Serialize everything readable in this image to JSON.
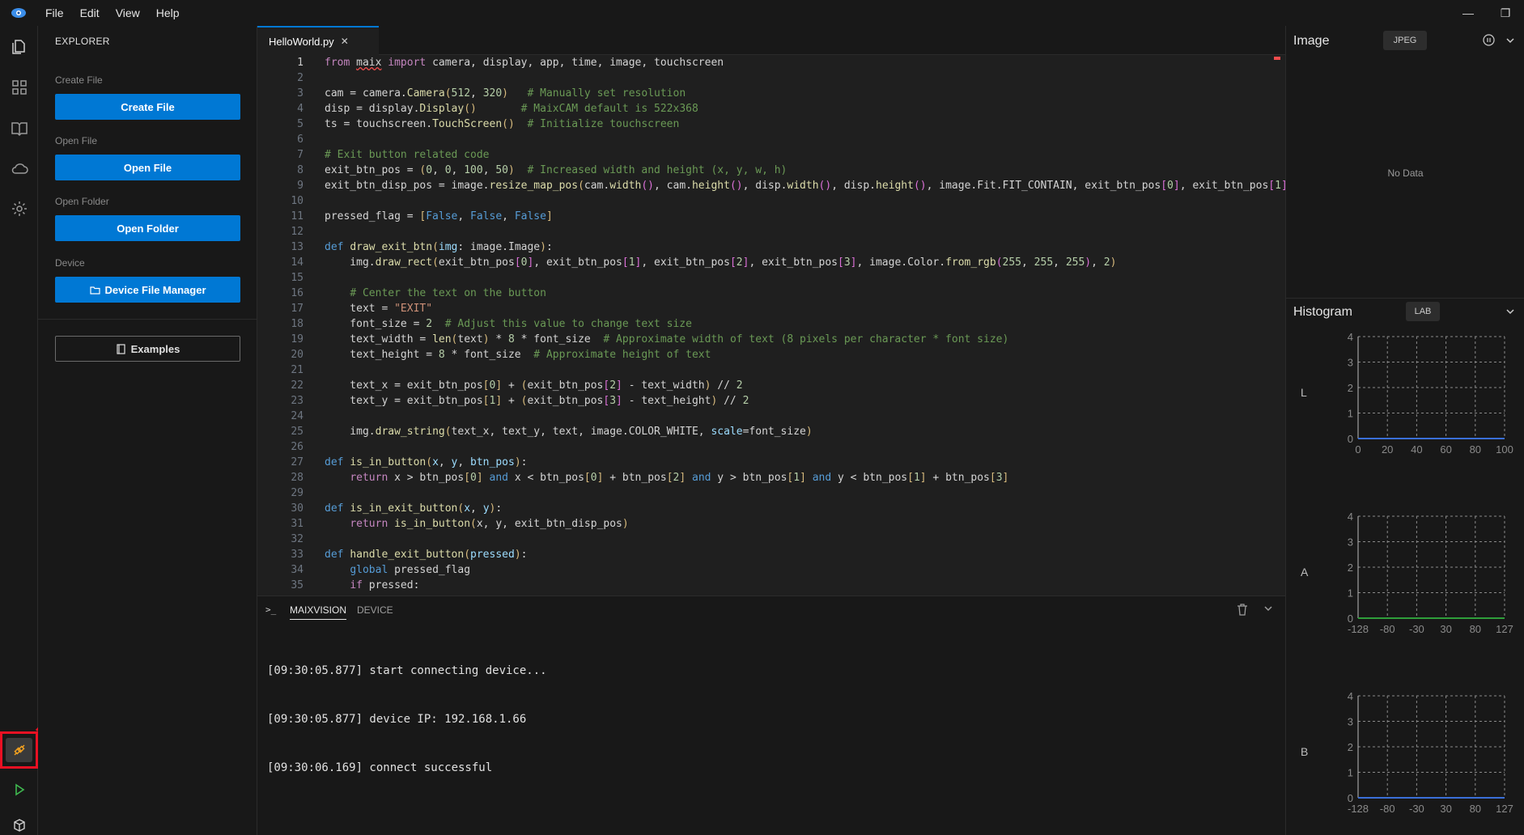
{
  "menu": {
    "file": "File",
    "edit": "Edit",
    "view": "View",
    "help": "Help"
  },
  "window": {
    "minimize": "—",
    "restore": "❐"
  },
  "sidebar": {
    "title": "EXPLORER",
    "create_label": "Create File",
    "create_button": "Create File",
    "open_label": "Open File",
    "open_button": "Open File",
    "folder_label": "Open Folder",
    "folder_button": "Open Folder",
    "device_label": "Device",
    "device_button": "Device File Manager",
    "examples_button": "Examples"
  },
  "editor": {
    "tab_name": "HelloWorld.py",
    "tab_close": "✕",
    "line_numbers": [
      "1",
      "2",
      "3",
      "4",
      "5",
      "6",
      "7",
      "8",
      "9",
      "10",
      "11",
      "12",
      "13",
      "14",
      "15",
      "16",
      "17",
      "18",
      "19",
      "20",
      "21",
      "22",
      "23",
      "24",
      "25",
      "26",
      "27",
      "28",
      "29",
      "30",
      "31",
      "32",
      "33",
      "34",
      "35"
    ]
  },
  "panel": {
    "prompt_symbol": ">_",
    "tab_maixvision": "MAIXVISION",
    "tab_device": "DEVICE",
    "log": [
      "[09:30:05.877] start connecting device...",
      "[09:30:05.877] device IP: 192.168.1.66",
      "[09:30:06.169] connect successful"
    ]
  },
  "image_panel": {
    "title": "Image",
    "format": "JPEG",
    "empty_text": "No Data"
  },
  "histogram": {
    "title": "Histogram",
    "mode": "LAB",
    "charts": [
      {
        "channel": "L",
        "y_ticks": [
          "0",
          "1",
          "2",
          "3",
          "4"
        ],
        "x_ticks": [
          "0",
          "20",
          "40",
          "60",
          "80",
          "100"
        ],
        "line_color": "#3a6fd8"
      },
      {
        "channel": "A",
        "y_ticks": [
          "0",
          "1",
          "2",
          "3",
          "4"
        ],
        "x_ticks": [
          "-128",
          "-80",
          "-30",
          "30",
          "80",
          "127"
        ],
        "line_color": "#2e9e3a"
      },
      {
        "channel": "B",
        "y_ticks": [
          "0",
          "1",
          "2",
          "3",
          "4"
        ],
        "x_ticks": [
          "-128",
          "-80",
          "-30",
          "30",
          "80",
          "127"
        ],
        "line_color": "#3a6fd8"
      }
    ]
  },
  "colors": {
    "accent": "#0078d4",
    "highlight_box": "#e81123"
  }
}
